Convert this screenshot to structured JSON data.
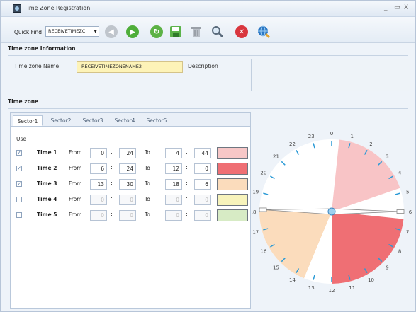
{
  "window": {
    "title": "Time Zone Registration",
    "min": "_",
    "max": "▭",
    "close": "X"
  },
  "toolbar": {
    "quick_find_label": "Quick Find",
    "quick_find_value": "RECEIVETIMEZC"
  },
  "info": {
    "header": "Time zone Information",
    "name_label": "Time zone Name",
    "name_value": "RECEIVETIMEZONENAME2",
    "desc_label": "Description"
  },
  "tz": {
    "header": "Time zone",
    "tabs": [
      "Sector1",
      "Sector2",
      "Sector3",
      "Sector4",
      "Sector5"
    ],
    "use_label": "Use",
    "from_label": "From",
    "to_label": "To",
    "rows": [
      {
        "name": "Time 1",
        "checked": true,
        "from_h": "0",
        "from_m": "24",
        "to_h": "4",
        "to_m": "44",
        "color": "#f7c7c7",
        "enabled": true
      },
      {
        "name": "Time 2",
        "checked": true,
        "from_h": "6",
        "from_m": "24",
        "to_h": "12",
        "to_m": "0",
        "color": "#ef6f74",
        "enabled": true
      },
      {
        "name": "Time 3",
        "checked": true,
        "from_h": "13",
        "from_m": "30",
        "to_h": "18",
        "to_m": "6",
        "color": "#fbdcbc",
        "enabled": true
      },
      {
        "name": "Time 4",
        "checked": false,
        "from_h": "0",
        "from_m": "0",
        "to_h": "0",
        "to_m": "0",
        "color": "#f7f3bb",
        "enabled": false
      },
      {
        "name": "Time 5",
        "checked": false,
        "from_h": "0",
        "from_m": "0",
        "to_h": "0",
        "to_m": "0",
        "color": "#d7ebc5",
        "enabled": false
      }
    ]
  },
  "clock": {
    "hours": [
      "0",
      "1",
      "2",
      "3",
      "4",
      "5",
      "6",
      "7",
      "8",
      "9",
      "10",
      "11",
      "12",
      "13",
      "14",
      "15",
      "16",
      "17",
      "18",
      "19",
      "20",
      "21",
      "22",
      "23"
    ],
    "segments": [
      {
        "from": 0.4,
        "to": 4.733,
        "color": "#f8c4c6"
      },
      {
        "from": 6.4,
        "to": 12.0,
        "color": "#ef6f74"
      },
      {
        "from": 13.5,
        "to": 18.1,
        "color": "#fbdcbc"
      }
    ],
    "hand_hours": [
      18.1,
      6.0
    ]
  }
}
